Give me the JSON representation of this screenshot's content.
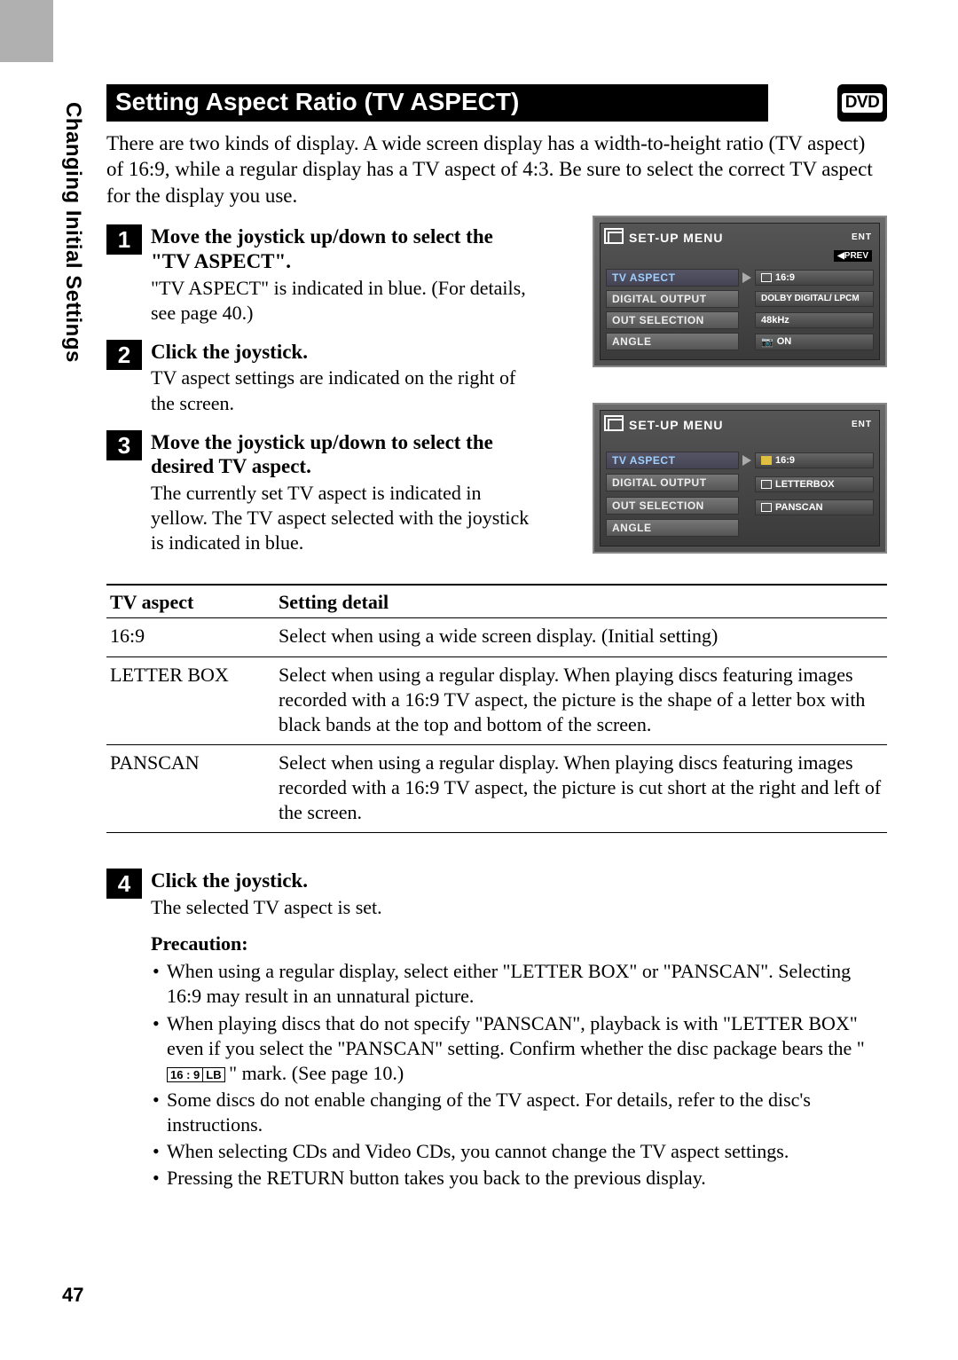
{
  "sidebar_label": "Changing Initial Settings",
  "page_number": "47",
  "title": "Setting Aspect Ratio (TV ASPECT)",
  "dvd_badge": "DVD",
  "intro": "There are two kinds of display. A wide screen display has a width-to-height ratio (TV aspect) of 16:9, while a regular display has a TV aspect of 4:3. Be sure to select the correct TV aspect for the display you use.",
  "steps": [
    {
      "num": "1",
      "title": "Move the joystick up/down to select the \"TV ASPECT\".",
      "body": "\"TV ASPECT\" is indicated in blue. (For details, see page 40.)"
    },
    {
      "num": "2",
      "title": "Click the joystick.",
      "body": "TV aspect settings are indicated on the right of the screen."
    },
    {
      "num": "3",
      "title": "Move the joystick up/down to select the desired TV aspect.",
      "body": "The currently set TV aspect is indicated in yellow. The TV aspect selected with the joystick is indicated in blue."
    }
  ],
  "step4": {
    "num": "4",
    "title": "Click the joystick.",
    "body": "The selected TV aspect is set."
  },
  "menu": {
    "title": "SET-UP MENU",
    "ent": "ENT",
    "prev": "◀PREV",
    "rows": {
      "tv_aspect": "TV ASPECT",
      "digital_output": "DIGITAL OUTPUT",
      "out_selection": "OUT SELECTION",
      "angle": "ANGLE"
    },
    "fig1_values": {
      "tv_aspect": "16:9",
      "digital_output": "DOLBY DIGITAL/ LPCM",
      "out_selection": "48kHz",
      "angle": "ON"
    },
    "fig2_options": {
      "opt1": "16:9",
      "opt2": "LETTERBOX",
      "opt3": "PANSCAN"
    }
  },
  "table": {
    "headers": {
      "aspect": "TV aspect",
      "detail": "Setting detail"
    },
    "rows": [
      {
        "aspect": "16:9",
        "detail": "Select when using a wide screen display. (Initial setting)"
      },
      {
        "aspect": "LETTER BOX",
        "detail": "Select when using a regular display. When playing discs featuring images recorded with a 16:9 TV aspect, the picture is the shape of a letter box with black bands at the top and bottom of the screen."
      },
      {
        "aspect": "PANSCAN",
        "detail": "Select when using a regular display. When playing discs featuring images recorded with a 16:9 TV aspect, the picture is cut short at the right and left of the screen."
      }
    ]
  },
  "precaution": {
    "title": "Precaution:",
    "items": {
      "p1": "When using a regular display, select either \"LETTER BOX\" or \"PANSCAN\". Selecting 16:9 may result in an unnatural picture.",
      "p2a": "When playing discs that do not specify \"PANSCAN\", playback is with \"LETTER BOX\" even if you select the \"PANSCAN\" setting. Confirm whether the disc package bears the \"",
      "p2_box1": "16 : 9",
      "p2_box2": "LB",
      "p2b": "\" mark. (See page 10.)",
      "p3": "Some discs do not enable changing of the TV aspect. For details, refer to the disc's instructions.",
      "p4": "When selecting CDs and Video CDs, you cannot change the TV aspect settings.",
      "p5": "Pressing the RETURN button takes you back to the previous display."
    }
  }
}
